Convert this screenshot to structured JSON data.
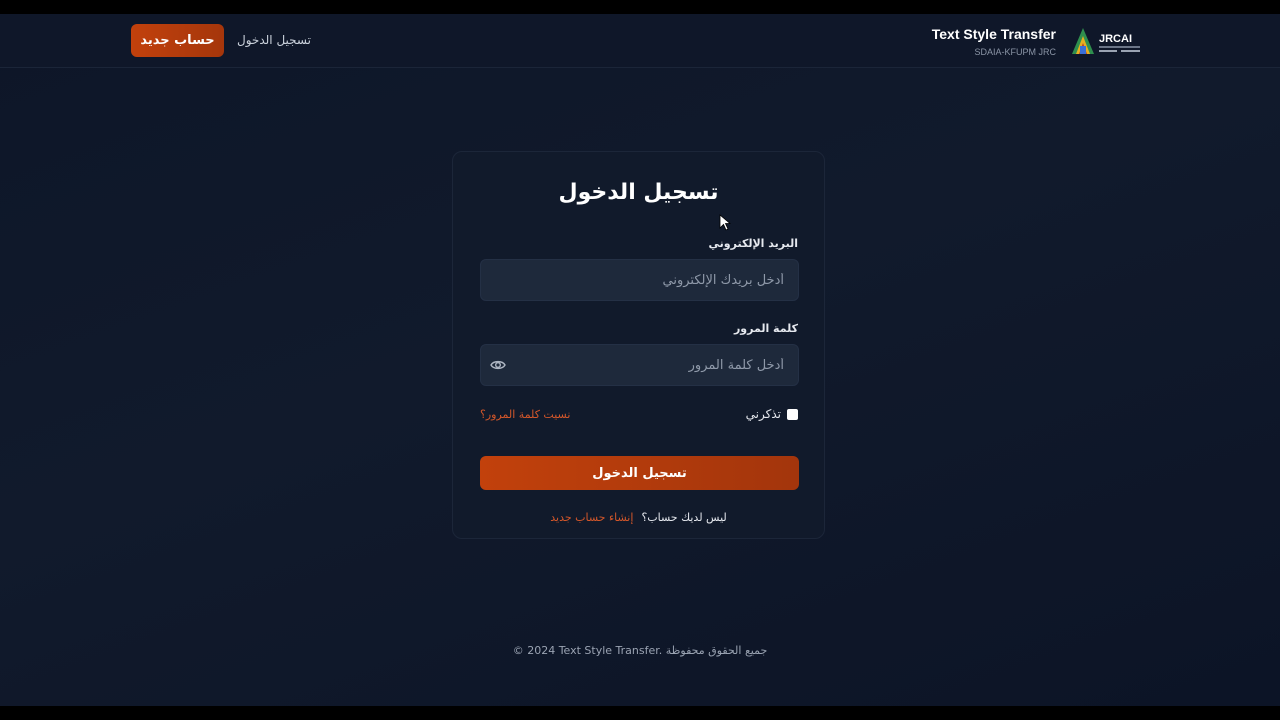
{
  "header": {
    "signup_button": "حساب جديد",
    "login_link": "تسجيل الدخول",
    "brand_title": "Text Style Transfer",
    "brand_subtitle": "SDAIA-KFUPM JRC",
    "logo_text": "JRCAI"
  },
  "card": {
    "title": "تسجيل الدخول",
    "email_label": "البريد الإلكتروني",
    "email_placeholder": "أدخل بريدك الإلكتروني",
    "password_label": "كلمة المرور",
    "password_placeholder": "أدخل كلمة المرور",
    "remember_label": "تذكرني",
    "forgot_link": "نسيت كلمة المرور؟",
    "submit_label": "تسجيل الدخول",
    "no_account_text": "ليس لديك حساب؟",
    "create_account_link": "إنشاء حساب جديد"
  },
  "footer": {
    "text": "© 2024 Text Style Transfer. جميع الحقوق محفوظة"
  },
  "colors": {
    "accent": "#c2410c",
    "link": "#d4572a",
    "background": "#0f1729"
  }
}
